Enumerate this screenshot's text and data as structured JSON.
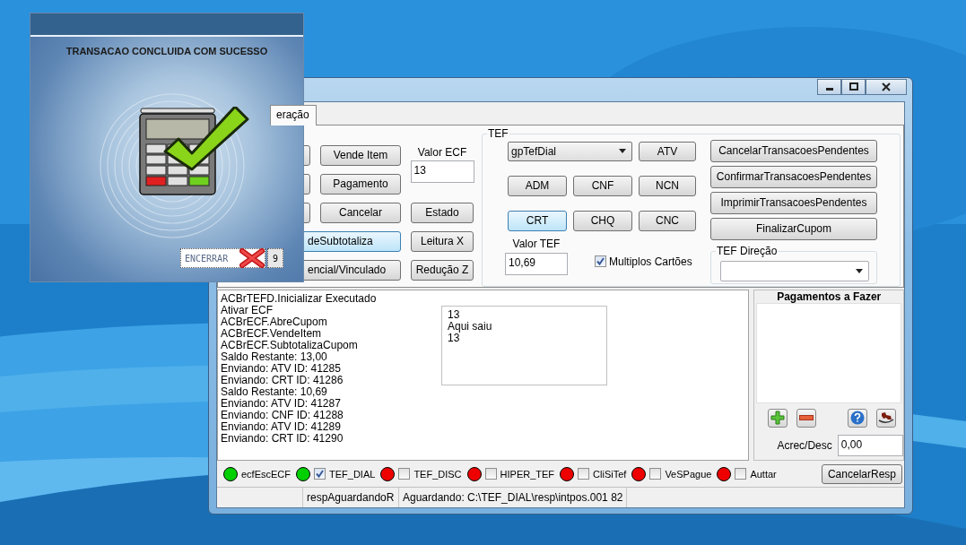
{
  "dialog": {
    "message": "TRANSACAO CONCLUIDA COM SUCESSO",
    "button": "ENCERRAR",
    "countdown": "9"
  },
  "tabs": [
    {
      "label": "eração",
      "selected": true
    }
  ],
  "ecf": {
    "column_2": [
      "Vende Item",
      "Pagamento",
      "Cancelar"
    ],
    "valor_label": "Valor ECF",
    "valor": "13",
    "column_3": [
      "Estado",
      "Leitura X",
      "Redução Z"
    ],
    "wide": [
      {
        "label": "deSubtotaliza",
        "focused": true
      },
      {
        "label": "encial/Vinculado",
        "focused": false
      }
    ]
  },
  "tef": {
    "legend": "TEF",
    "combo": "gpTefDial",
    "buttons": [
      {
        "label": "ATV",
        "focused": false
      },
      {
        "label": "ADM",
        "focused": false
      },
      {
        "label": "CNF",
        "focused": false
      },
      {
        "label": "NCN",
        "focused": false
      },
      {
        "label": "CRT",
        "focused": true
      },
      {
        "label": "CHQ",
        "focused": false
      },
      {
        "label": "CNC",
        "focused": false
      }
    ],
    "valor_label": "Valor TEF",
    "valor": "10,69",
    "multiplos": {
      "label": "Multiplos Cartões",
      "checked": true
    },
    "actions": [
      "CancelarTransacoesPendentes",
      "ConfirmarTransacoesPendentes",
      "ImprimirTransacoesPendentes",
      "FinalizarCupom"
    ],
    "direcao_legend": "TEF Direção"
  },
  "log": [
    "ACBrTEFD.Inicializar Executado",
    "Ativar ECF",
    "ACBrECF.AbreCupom",
    "ACBrECF.VendeItem",
    "ACBrECF.SubtotalizaCupom",
    "Saldo Restante: 13,00",
    "Enviando: ATV ID: 41285",
    "Enviando: CRT ID: 41286",
    "Saldo Restante: 10,69",
    "Enviando: ATV ID: 41287",
    "Enviando: CNF ID: 41288",
    "Enviando: ATV ID: 41289",
    "Enviando: CRT ID: 41290"
  ],
  "memo": [
    "13",
    "Aqui saiu",
    "13"
  ],
  "payments": {
    "title": "Pagamentos a Fazer",
    "acrec_label": "Acrec/Desc",
    "acrec_value": "0,00"
  },
  "indicators": [
    {
      "kind": "plain",
      "label": "ecfEscECF",
      "color": "#00d000"
    },
    {
      "kind": "check",
      "label": "TEF_DIAL",
      "color": "#00d000",
      "checked": true
    },
    {
      "kind": "check",
      "label": "TEF_DISC",
      "color": "#ee0000",
      "checked": false
    },
    {
      "kind": "check",
      "label": "HIPER_TEF",
      "color": "#ee0000",
      "checked": false
    },
    {
      "kind": "check",
      "label": "CliSiTef",
      "color": "#ee0000",
      "checked": false
    },
    {
      "kind": "check",
      "label": "VeSPague",
      "color": "#ee0000",
      "checked": false
    },
    {
      "kind": "check",
      "label": "Auttar",
      "color": "#ee0000",
      "checked": false
    }
  ],
  "cancel_button": "CancelarResp",
  "status_bar": [
    "respAguardandoR",
    "Aguardando: C:\\TEF_DIAL\\resp\\intpos.001 82"
  ]
}
